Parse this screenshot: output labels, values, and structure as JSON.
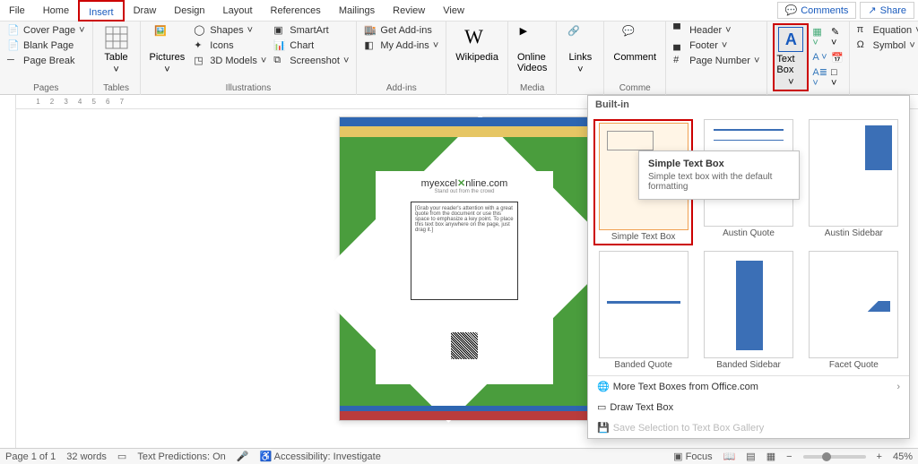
{
  "tabs": [
    "File",
    "Home",
    "Insert",
    "Draw",
    "Design",
    "Layout",
    "References",
    "Mailings",
    "Review",
    "View"
  ],
  "active_tab": "Insert",
  "titlebar": {
    "comments": "Comments",
    "share": "Share"
  },
  "ribbon": {
    "pages": {
      "label": "Pages",
      "cover": "Cover Page",
      "blank": "Blank Page",
      "break": "Page Break"
    },
    "tables": {
      "label": "Tables",
      "table": "Table"
    },
    "illus": {
      "label": "Illustrations",
      "pictures": "Pictures",
      "shapes": "Shapes",
      "icons": "Icons",
      "models": "3D Models",
      "smartart": "SmartArt",
      "chart": "Chart",
      "screenshot": "Screenshot"
    },
    "addins": {
      "label": "Add-ins",
      "get": "Get Add-ins",
      "my": "My Add-ins"
    },
    "wiki": "Wikipedia",
    "media": {
      "label": "Media",
      "video": "Online Videos"
    },
    "links": "Links",
    "comment_grp": {
      "label": "Comme",
      "comment": "Comment"
    },
    "header_grp": {
      "header": "Header",
      "footer": "Footer",
      "pagenum": "Page Number"
    },
    "textbox": "Text Box",
    "symbols": {
      "equation": "Equation",
      "symbol": "Symbol"
    }
  },
  "dropdown": {
    "heading": "Built-in",
    "items": [
      {
        "label": "Simple Text Box",
        "thumb": "simple",
        "sel": true
      },
      {
        "label": "Austin Quote",
        "thumb": "aq"
      },
      {
        "label": "Austin Sidebar",
        "thumb": "as"
      },
      {
        "label": "Banded Quote",
        "thumb": "bq"
      },
      {
        "label": "Banded Sidebar",
        "thumb": "bs"
      },
      {
        "label": "Facet Quote",
        "thumb": "fq"
      }
    ],
    "more": "More Text Boxes from Office.com",
    "draw": "Draw Text Box",
    "save": "Save Selection to Text Box Gallery"
  },
  "tooltip": {
    "title": "Simple Text Box",
    "desc": "Simple text box with the default formatting"
  },
  "doc": {
    "logo1": "myexcel",
    "logo2": "nline.com",
    "logosub": "Stand out from the crowd",
    "textbox_preview": "[Grab your reader's attention with a great quote from the document or use this space to emphasize a key point. To place this text box anywhere on the page, just drag it.]"
  },
  "status": {
    "page": "Page 1 of 1",
    "words": "32 words",
    "pred": "Text Predictions: On",
    "access": "Accessibility: Investigate",
    "focus": "Focus",
    "zoom": "45%"
  }
}
